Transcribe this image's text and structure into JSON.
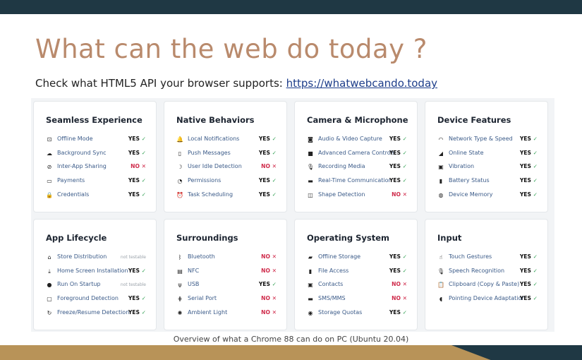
{
  "title": "What can the web do today ?",
  "subtitle": {
    "text": "Check what HTML5 API your browser supports: ",
    "link": "https://whatwebcando.today"
  },
  "caption": "Overview of what a Chrome 88 can do on PC (Ubuntu 20.04)",
  "status_text": {
    "yes": "YES",
    "no": "NO",
    "not_testable": "not testable",
    "yes_mark": "✓",
    "no_mark": "✕"
  },
  "cards": [
    {
      "title": "Seamless Experience",
      "items": [
        {
          "label": "Offline Mode",
          "status": "yes",
          "icon": "offline-icon"
        },
        {
          "label": "Background Sync",
          "status": "yes",
          "icon": "cloud-sync-icon"
        },
        {
          "label": "Inter-App Sharing",
          "status": "no",
          "icon": "share-icon"
        },
        {
          "label": "Payments",
          "status": "yes",
          "icon": "credit-card-icon"
        },
        {
          "label": "Credentials",
          "status": "yes",
          "icon": "lock-icon"
        }
      ]
    },
    {
      "title": "Native Behaviors",
      "items": [
        {
          "label": "Local Notifications",
          "status": "yes",
          "icon": "bell-icon"
        },
        {
          "label": "Push Messages",
          "status": "yes",
          "icon": "phone-icon"
        },
        {
          "label": "User Idle Detection",
          "status": "no",
          "icon": "moon-icon"
        },
        {
          "label": "Permissions",
          "status": "yes",
          "icon": "permission-icon"
        },
        {
          "label": "Task Scheduling",
          "status": "yes",
          "icon": "alarm-clock-icon"
        }
      ]
    },
    {
      "title": "Camera & Microphone",
      "items": [
        {
          "label": "Audio & Video Capture",
          "status": "yes",
          "icon": "camera-icon"
        },
        {
          "label": "Advanced Camera Controls",
          "status": "yes",
          "icon": "video-camera-icon"
        },
        {
          "label": "Recording Media",
          "status": "yes",
          "icon": "microphone-icon"
        },
        {
          "label": "Real-Time Communication",
          "status": "yes",
          "icon": "video-call-icon"
        },
        {
          "label": "Shape Detection",
          "status": "no",
          "icon": "shape-icon"
        }
      ]
    },
    {
      "title": "Device Features",
      "items": [
        {
          "label": "Network Type & Speed",
          "status": "yes",
          "icon": "speedometer-icon"
        },
        {
          "label": "Online State",
          "status": "yes",
          "icon": "signal-icon"
        },
        {
          "label": "Vibration",
          "status": "yes",
          "icon": "vibration-icon"
        },
        {
          "label": "Battery Status",
          "status": "yes",
          "icon": "battery-icon"
        },
        {
          "label": "Device Memory",
          "status": "yes",
          "icon": "memory-chip-icon"
        }
      ]
    },
    {
      "title": "App Lifecycle",
      "items": [
        {
          "label": "Store Distribution",
          "status": "nt",
          "icon": "store-icon"
        },
        {
          "label": "Home Screen Installation",
          "status": "yes",
          "icon": "download-icon"
        },
        {
          "label": "Run On Startup",
          "status": "nt",
          "icon": "power-icon"
        },
        {
          "label": "Foreground Detection",
          "status": "yes",
          "icon": "window-icon"
        },
        {
          "label": "Freeze/Resume Detection",
          "status": "yes",
          "icon": "refresh-icon"
        }
      ]
    },
    {
      "title": "Surroundings",
      "items": [
        {
          "label": "Bluetooth",
          "status": "no",
          "icon": "bluetooth-icon"
        },
        {
          "label": "NFC",
          "status": "no",
          "icon": "nfc-icon"
        },
        {
          "label": "USB",
          "status": "yes",
          "icon": "usb-icon"
        },
        {
          "label": "Serial Port",
          "status": "no",
          "icon": "serial-port-icon"
        },
        {
          "label": "Ambient Light",
          "status": "no",
          "icon": "sun-icon"
        }
      ]
    },
    {
      "title": "Operating System",
      "items": [
        {
          "label": "Offline Storage",
          "status": "yes",
          "icon": "folder-icon"
        },
        {
          "label": "File Access",
          "status": "yes",
          "icon": "file-icon"
        },
        {
          "label": "Contacts",
          "status": "no",
          "icon": "contacts-icon"
        },
        {
          "label": "SMS/MMS",
          "status": "no",
          "icon": "message-icon"
        },
        {
          "label": "Storage Quotas",
          "status": "yes",
          "icon": "database-icon"
        }
      ]
    },
    {
      "title": "Input",
      "items": [
        {
          "label": "Touch Gestures",
          "status": "yes",
          "icon": "touch-icon"
        },
        {
          "label": "Speech Recognition",
          "status": "yes",
          "icon": "microphone-icon"
        },
        {
          "label": "Clipboard (Copy & Paste)",
          "status": "yes",
          "icon": "clipboard-icon"
        },
        {
          "label": "Pointing Device Adaptation",
          "status": "yes",
          "icon": "mouse-icon"
        }
      ]
    }
  ]
}
